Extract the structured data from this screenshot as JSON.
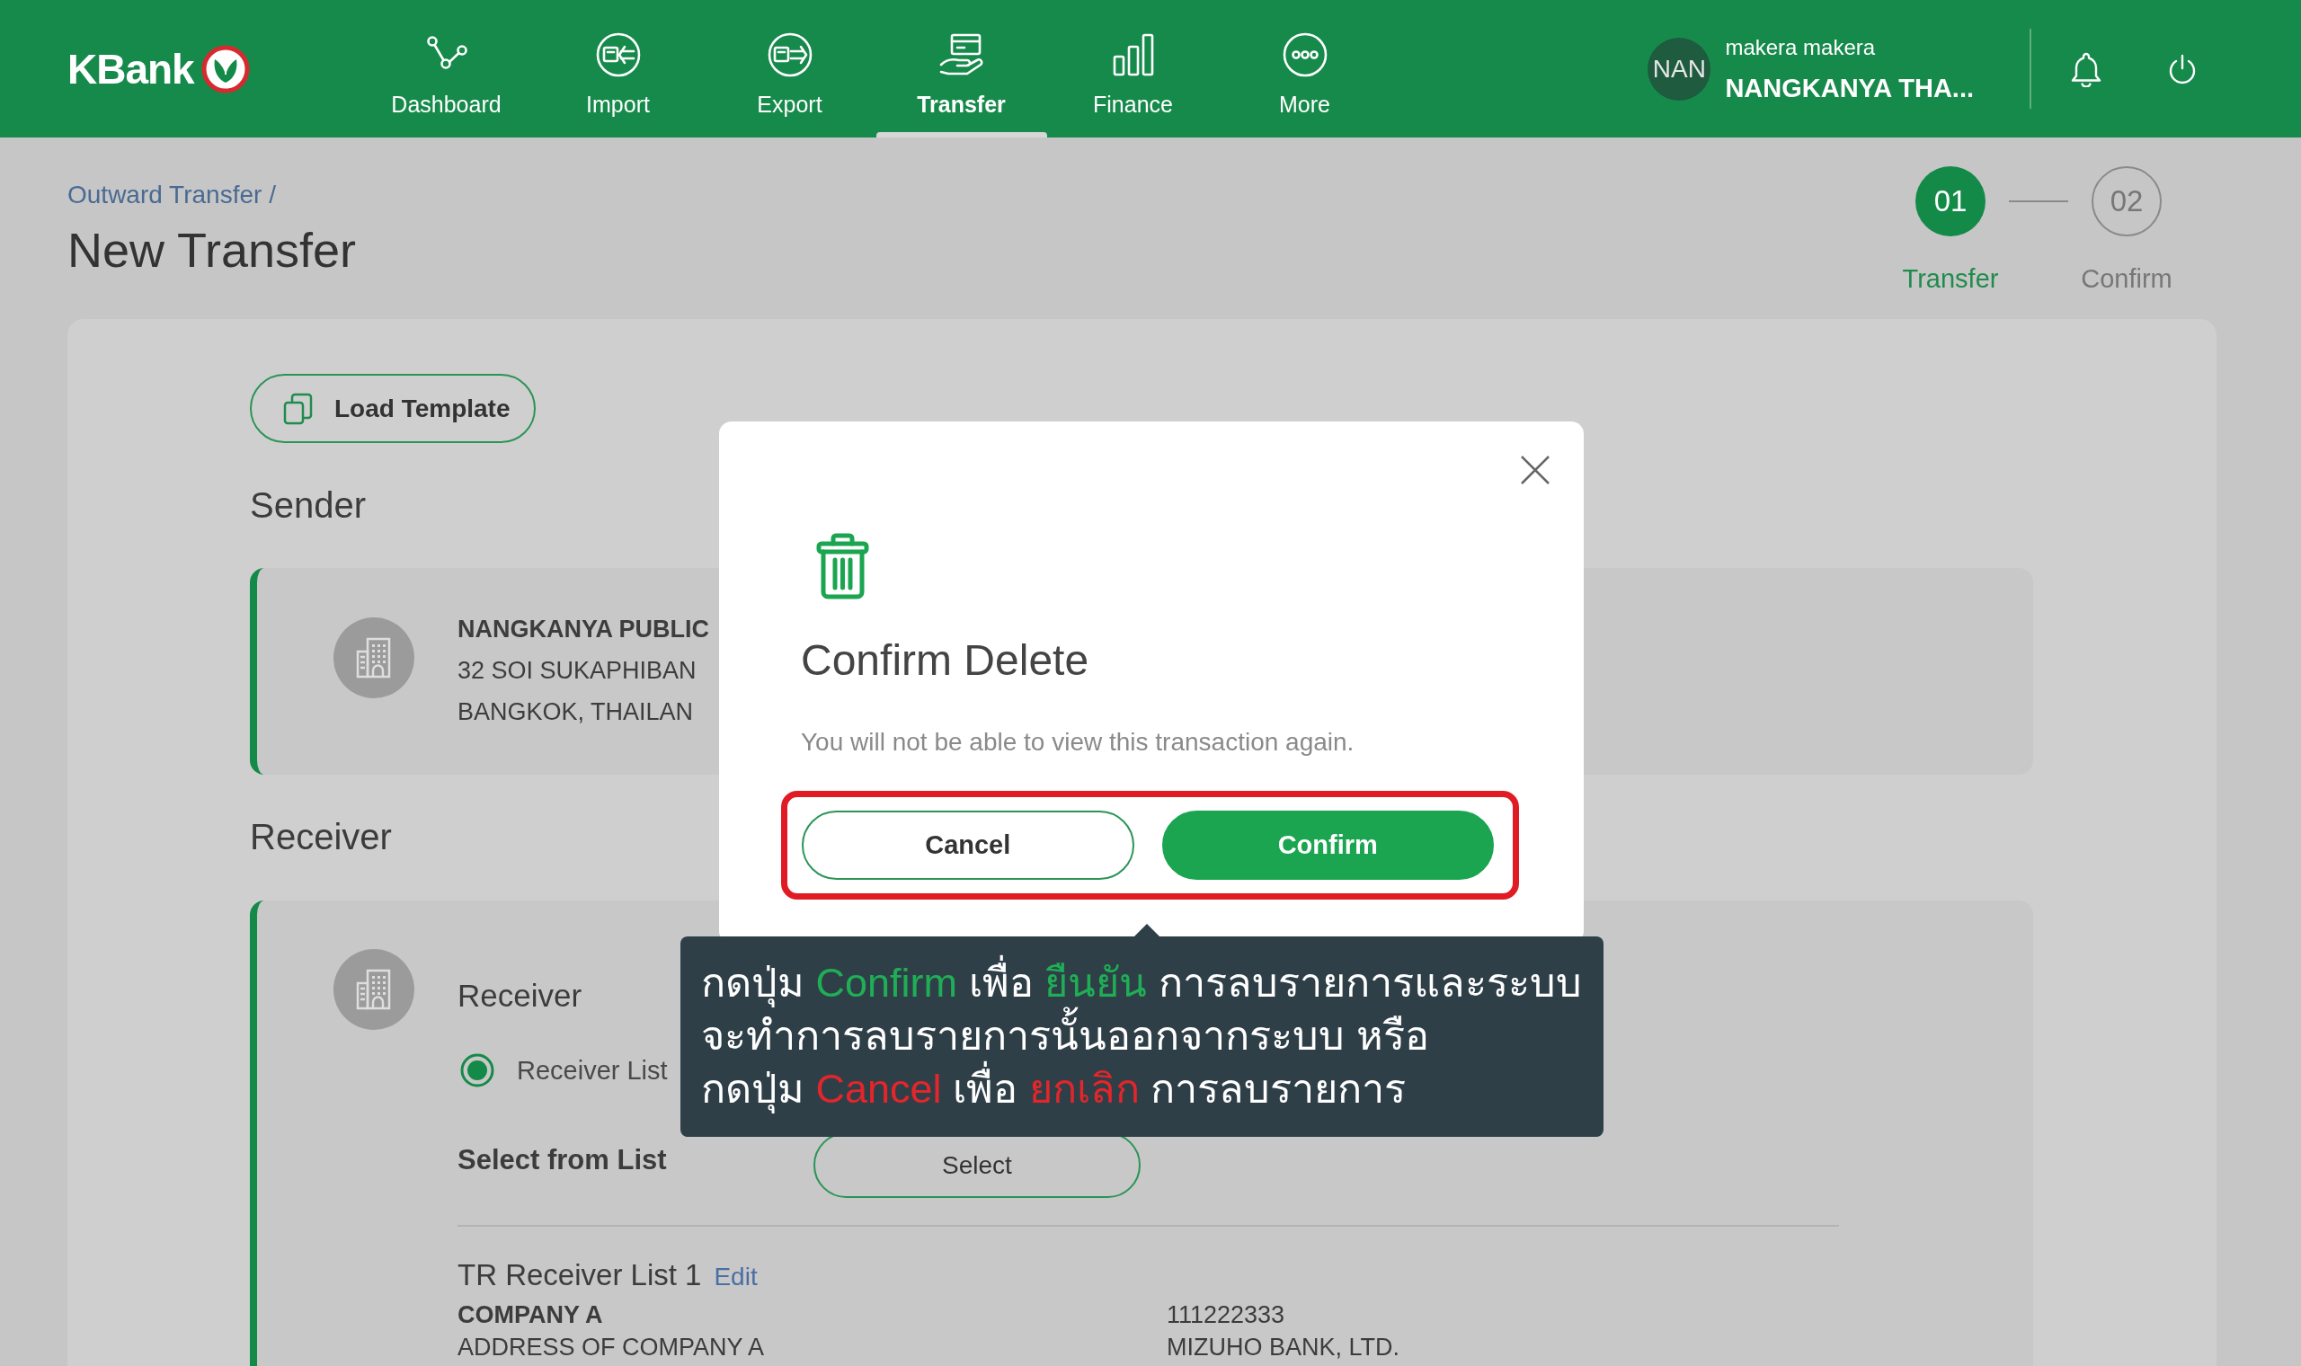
{
  "header": {
    "logo": "KBank",
    "nav": [
      {
        "label": "Dashboard",
        "selected": false
      },
      {
        "label": "Import",
        "selected": false
      },
      {
        "label": "Export",
        "selected": false
      },
      {
        "label": "Transfer",
        "selected": true
      },
      {
        "label": "Finance",
        "selected": false
      },
      {
        "label": "More",
        "selected": false
      }
    ],
    "user": {
      "initials": "NAN",
      "user_name": "makera makera",
      "company": "NANGKANYA THA..."
    }
  },
  "page": {
    "breadcrumb": [
      {
        "label": "Outward Transfer"
      }
    ],
    "breadcrumb_separator": "/",
    "title": "New Transfer"
  },
  "stepper": [
    {
      "number": "01",
      "label": "Transfer",
      "active": true
    },
    {
      "number": "02",
      "label": "Confirm",
      "active": false
    }
  ],
  "form": {
    "load_template": "Load Template",
    "sender": {
      "heading": "Sender",
      "lines": [
        "NANGKANYA PUBLIC",
        "32 SOI SUKAPHIBAN",
        "BANGKOK, THAILAN"
      ]
    },
    "receiver": {
      "heading": "Receiver",
      "card_title": "Receiver",
      "options": [
        {
          "label": "Receiver List",
          "selected": true
        }
      ],
      "select_label": "Select from List",
      "select_button": "Select",
      "list_title": "TR Receiver List 1",
      "edit_link": "Edit",
      "details": [
        [
          "COMPANY A",
          "111222333"
        ],
        [
          "ADDRESS OF COMPANY A",
          "MIZUHO BANK, LTD."
        ]
      ]
    }
  },
  "dialog": {
    "title": "Confirm Delete",
    "message": "You will not be able to view this transaction again.",
    "buttons": [
      {
        "label": "Cancel",
        "kind": "secondary"
      },
      {
        "label": "Confirm",
        "kind": "primary"
      }
    ]
  },
  "tooltip": {
    "lines": [
      [
        {
          "text": "กดปุ่ม "
        },
        {
          "text": "Confirm",
          "color": "#1fae55"
        },
        {
          "text": " เพื่อ "
        },
        {
          "text": "ยืนยัน",
          "color": "#1fae55"
        },
        {
          "text": " การลบรายการและระบบ"
        }
      ],
      [
        {
          "text": "จะทำการลบรายการนั้นออกจากระบบ หรือ"
        }
      ],
      [
        {
          "text": "กดปุ่ม "
        },
        {
          "text": "Cancel",
          "color": "#e3262b"
        },
        {
          "text": " เพื่อ "
        },
        {
          "text": "ยกเลิก",
          "color": "#e3262b"
        },
        {
          "text": " การลบรายการ"
        }
      ]
    ]
  }
}
